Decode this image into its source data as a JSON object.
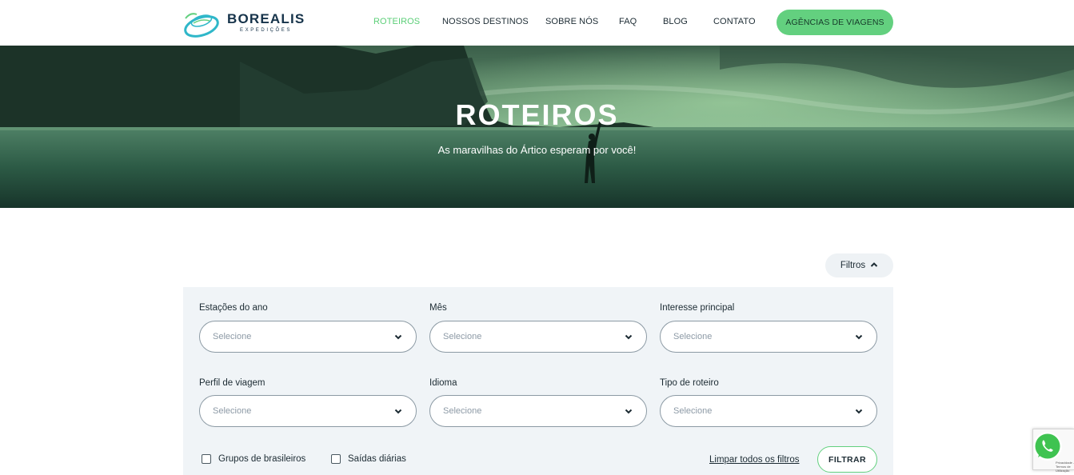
{
  "brand": {
    "name": "BOREALIS",
    "sub": "EXPEDIÇÕES",
    "accent": "#63d07f",
    "dark": "#16334a"
  },
  "nav": {
    "items": [
      {
        "label": "ROTEIROS",
        "active": true
      },
      {
        "label": "NOSSOS DESTINOS",
        "active": false
      },
      {
        "label": "SOBRE NÓS",
        "active": false
      },
      {
        "label": "FAQ",
        "active": false
      },
      {
        "label": "BLOG",
        "active": false
      },
      {
        "label": "CONTATO",
        "active": false
      }
    ],
    "cta": "AGÊNCIAS DE VIAGENS"
  },
  "hero": {
    "title": "ROTEIROS",
    "subtitle": "As maravilhas do Ártico esperam por você!"
  },
  "filters": {
    "toggle_label": "Filtros",
    "fields": [
      {
        "label": "Estações do ano",
        "placeholder": "Selecione"
      },
      {
        "label": "Mês",
        "placeholder": "Selecione"
      },
      {
        "label": "Interesse principal",
        "placeholder": "Selecione"
      },
      {
        "label": "Perfil de viagem",
        "placeholder": "Selecione"
      },
      {
        "label": "Idioma",
        "placeholder": "Selecione"
      },
      {
        "label": "Tipo de roteiro",
        "placeholder": "Selecione"
      }
    ],
    "checkboxes": [
      {
        "label": "Grupos de brasileiros",
        "checked": false
      },
      {
        "label": "Saídas diárias",
        "checked": false
      }
    ],
    "clear_label": "Limpar todos os filtros",
    "submit_label": "FILTRAR"
  },
  "recaptcha": {
    "text": "Privacidade - Termos de Utilização"
  }
}
